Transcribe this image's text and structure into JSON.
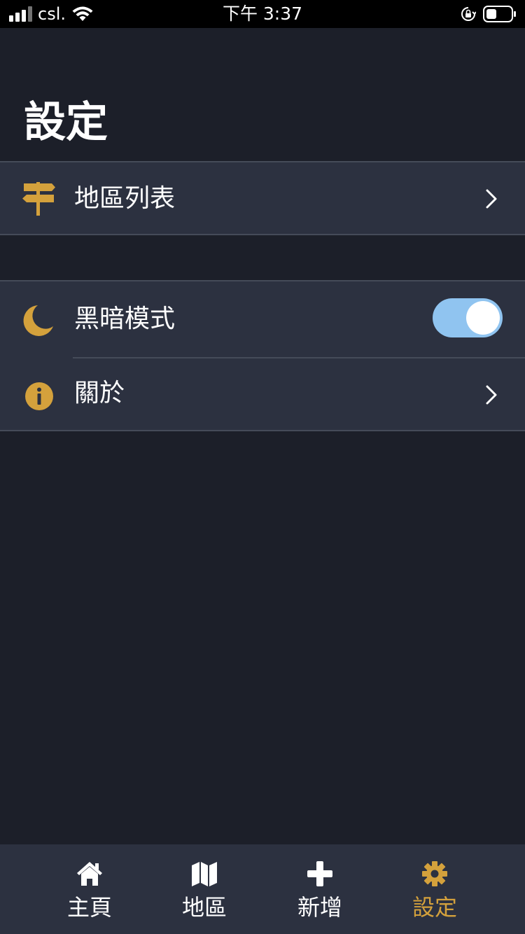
{
  "status_bar": {
    "carrier": "csl.",
    "time": "下午 3:37"
  },
  "header": {
    "title": "設定"
  },
  "settings": {
    "region_list_label": "地區列表",
    "dark_mode_label": "黑暗模式",
    "dark_mode_enabled": true,
    "about_label": "關於"
  },
  "tab_bar": {
    "tabs": [
      {
        "label": "主頁",
        "icon": "home-icon"
      },
      {
        "label": "地區",
        "icon": "map-icon"
      },
      {
        "label": "新增",
        "icon": "plus-icon"
      },
      {
        "label": "設定",
        "icon": "gear-icon",
        "active": true
      }
    ]
  },
  "colors": {
    "background": "#1c1f29",
    "surface": "#2c3140",
    "accent": "#d4a13c",
    "toggle_on": "#90c4f0"
  }
}
